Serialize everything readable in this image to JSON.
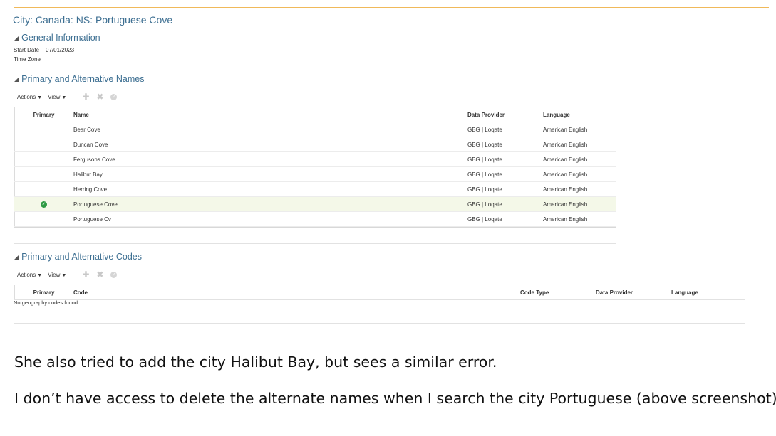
{
  "page": {
    "title": "City: Canada: NS: Portuguese Cove"
  },
  "general_info": {
    "heading": "General Information",
    "start_date_label": "Start Date",
    "start_date_value": "07/01/2023",
    "time_zone_label": "Time Zone",
    "time_zone_value": ""
  },
  "names_section": {
    "heading": "Primary and Alternative Names",
    "toolbar": {
      "actions_label": "Actions",
      "view_label": "View"
    },
    "columns": {
      "primary": "Primary",
      "name": "Name",
      "data_provider": "Data Provider",
      "language": "Language"
    },
    "rows": [
      {
        "primary": false,
        "name": "Bear Cove",
        "data_provider": "GBG | Loqate",
        "language": "American English"
      },
      {
        "primary": false,
        "name": "Duncan Cove",
        "data_provider": "GBG | Loqate",
        "language": "American English"
      },
      {
        "primary": false,
        "name": "Fergusons Cove",
        "data_provider": "GBG | Loqate",
        "language": "American English"
      },
      {
        "primary": false,
        "name": "Halibut Bay",
        "data_provider": "GBG | Loqate",
        "language": "American English"
      },
      {
        "primary": false,
        "name": "Herring Cove",
        "data_provider": "GBG | Loqate",
        "language": "American English"
      },
      {
        "primary": true,
        "name": "Portuguese Cove",
        "data_provider": "GBG | Loqate",
        "language": "American English"
      },
      {
        "primary": false,
        "name": "Portuguese Cv",
        "data_provider": "GBG | Loqate",
        "language": "American English"
      }
    ]
  },
  "codes_section": {
    "heading": "Primary and Alternative Codes",
    "toolbar": {
      "actions_label": "Actions",
      "view_label": "View"
    },
    "columns": {
      "primary": "Primary",
      "code": "Code",
      "code_type": "Code Type",
      "data_provider": "Data Provider",
      "language": "Language"
    },
    "empty_message": "No geography codes found."
  },
  "document": {
    "paragraph_1": "She also tried to add the city Halibut Bay, but sees a similar error.",
    "paragraph_2": "I don’t have access to delete the alternate names when I search the city Portuguese (above screenshot)"
  },
  "colors": {
    "heading_blue": "#3c6e91",
    "top_rule": "#f0b95a",
    "primary_check": "#2e9a43",
    "selected_row": "#f4f8e8"
  },
  "icons": {
    "collapse": "triangle-down-icon",
    "add": "plus-icon",
    "delete": "x-icon",
    "save": "check-circle-icon",
    "primary_flag": "check-circle-icon"
  }
}
